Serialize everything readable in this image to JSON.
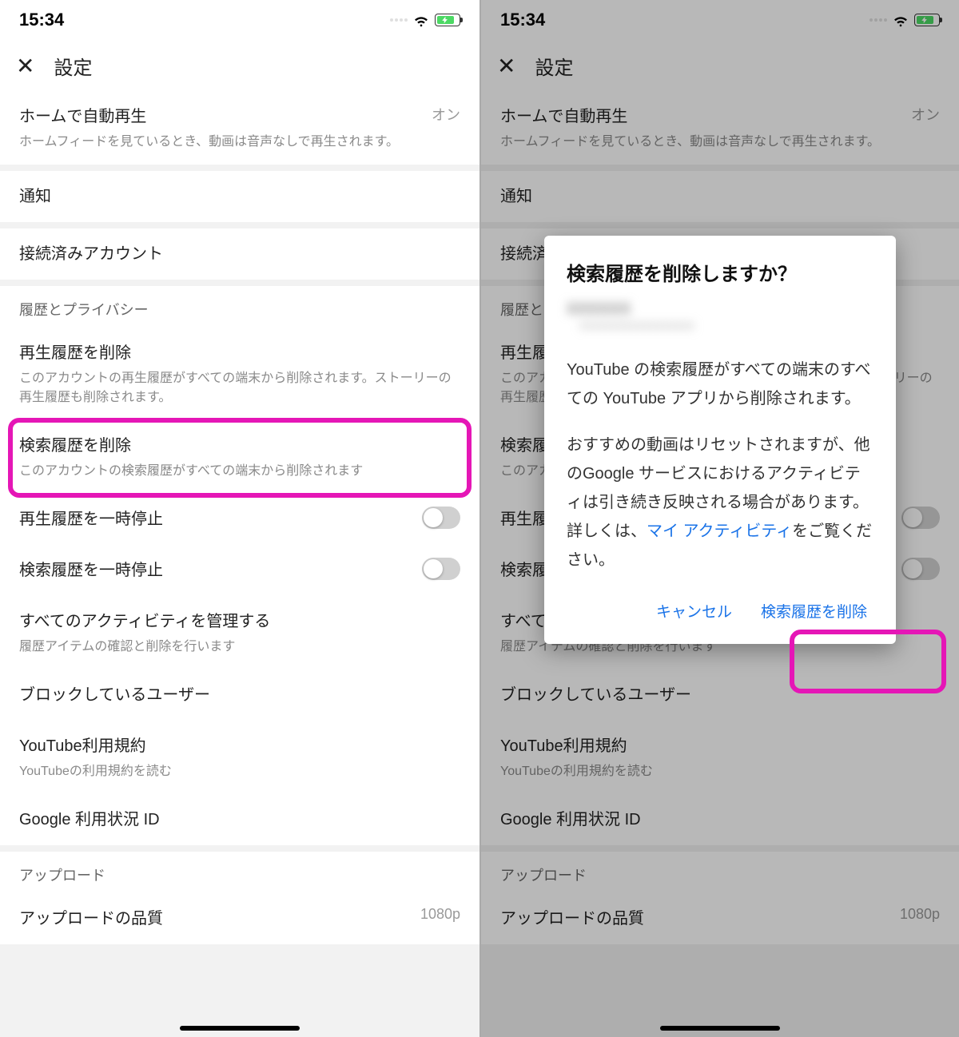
{
  "statusbar": {
    "time": "15:34"
  },
  "nav": {
    "title": "設定"
  },
  "rows": {
    "autoplay": {
      "title": "ホームで自動再生",
      "value": "オン",
      "desc": "ホームフィードを見ているとき、動画は音声なしで再生されます。"
    },
    "notifications": {
      "title": "通知"
    },
    "connected": {
      "title": "接続済みアカウント"
    },
    "section_privacy": "履歴とプライバシー",
    "clear_watch": {
      "title": "再生履歴を削除",
      "desc": "このアカウントの再生履歴がすべての端末から削除されます。ストーリーの再生履歴も削除されます。"
    },
    "clear_search": {
      "title": "検索履歴を削除",
      "desc": "このアカウントの検索履歴がすべての端末から削除されます"
    },
    "pause_watch": {
      "title": "再生履歴を一時停止"
    },
    "pause_search": {
      "title": "検索履歴を一時停止"
    },
    "manage_activity": {
      "title": "すべてのアクティビティを管理する",
      "desc": "履歴アイテムの確認と削除を行います"
    },
    "blocked": {
      "title": "ブロックしているユーザー"
    },
    "terms": {
      "title": "YouTube利用規約",
      "desc": "YouTubeの利用規約を読む"
    },
    "google_id": {
      "title": "Google 利用状況 ID"
    },
    "section_upload": "アップロード",
    "upload_quality": {
      "title": "アップロードの品質",
      "value": "1080p"
    }
  },
  "dialog": {
    "title": "検索履歴を削除しますか？",
    "body1": "YouTube の検索履歴がすべての端末のすべての YouTube アプリから削除されます。",
    "body2a": "おすすめの動画はリセットされますが、他のGoogle サービスにおけるアクティビティは引き続き反映される場合があります。詳しくは、",
    "body2_link": "マイ アクティビティ",
    "body2b": "をご覧ください。",
    "cancel": "キャンセル",
    "confirm": "検索履歴を削除"
  }
}
